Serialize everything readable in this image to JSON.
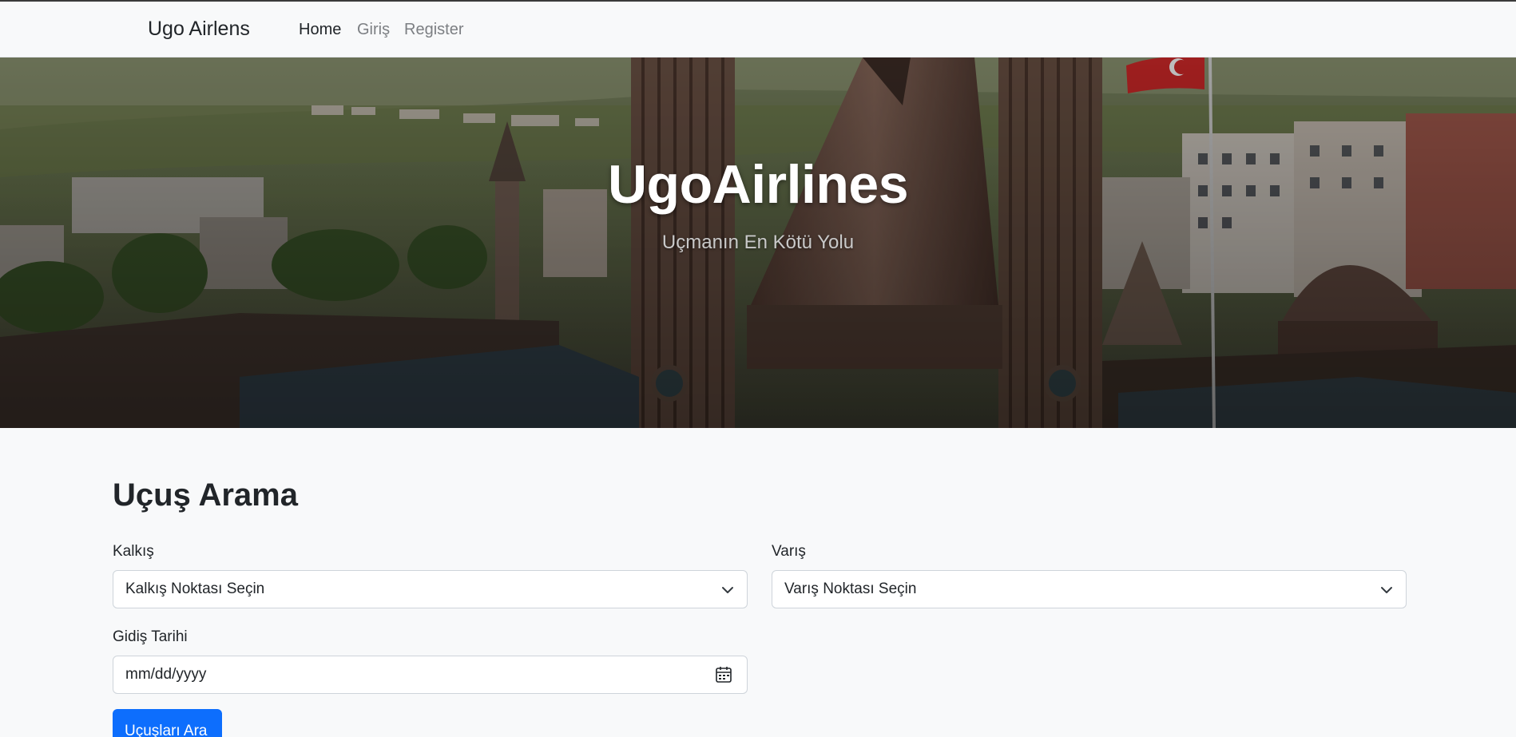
{
  "navbar": {
    "brand": "Ugo Airlens",
    "links": [
      {
        "label": "Home",
        "active": true
      },
      {
        "label": "Giriş",
        "active": false
      },
      {
        "label": "Register",
        "active": false
      }
    ]
  },
  "hero": {
    "title": "UgoAirlines",
    "subtitle": "Uçmanın En Kötü Yolu"
  },
  "search": {
    "heading": "Uçuş Arama",
    "departure": {
      "label": "Kalkış",
      "value": "Kalkış Noktası Seçin"
    },
    "arrival": {
      "label": "Varış",
      "value": "Varış Noktası Seçin"
    },
    "date": {
      "label": "Gidiş Tarihi",
      "placeholder": "mm/dd/yyyy"
    },
    "submit_label": "Uçuşları Ara"
  },
  "colors": {
    "primary": "#0d6efd",
    "background": "#f8f9fa",
    "text": "#212529",
    "muted_link": "#7c7f83"
  },
  "icons": [
    "chevron-down-icon",
    "calendar-icon",
    "turkish-flag"
  ]
}
